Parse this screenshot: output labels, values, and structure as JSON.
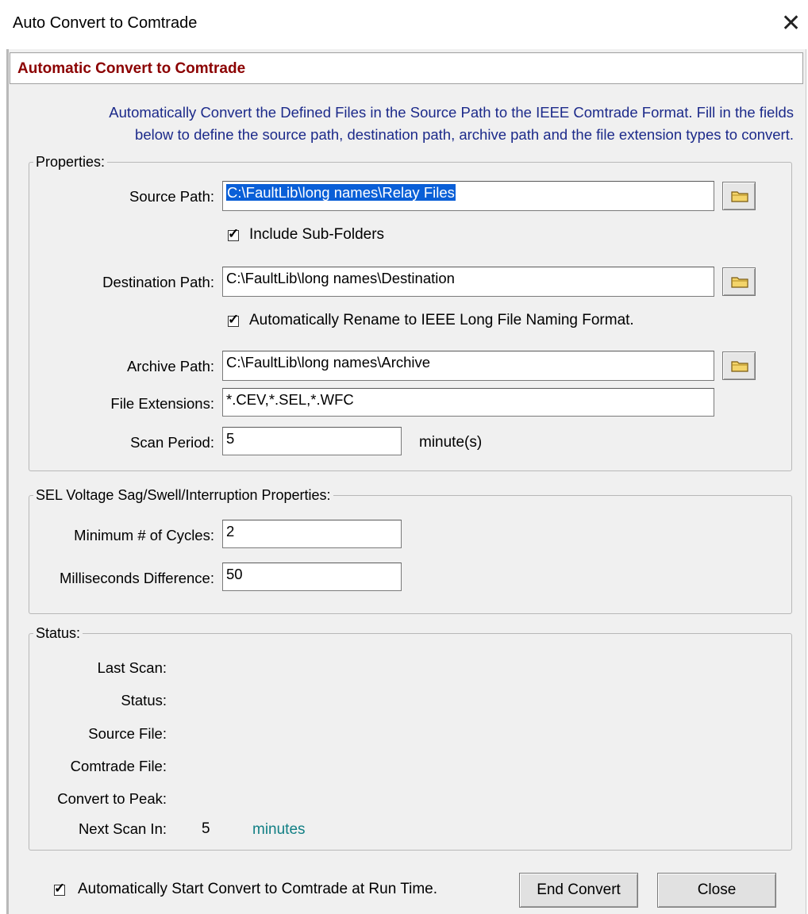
{
  "window": {
    "title": "Auto Convert to Comtrade",
    "close_glyph": "✕"
  },
  "header": {
    "title": "Automatic Convert to Comtrade"
  },
  "description": {
    "line1": "Automatically Convert the Defined Files in the Source Path to the IEEE Comtrade Format.  Fill in the fields",
    "line2": "below to define the source path, destination path, archive path and the file extension types to convert."
  },
  "properties": {
    "legend": "Properties:",
    "source_label": "Source Path:",
    "source_value": "C:\\FaultLib\\long names\\Relay Files",
    "include_subfolders_label": "Include Sub-Folders",
    "include_subfolders_checked": true,
    "destination_label": "Destination Path:",
    "destination_value": "C:\\FaultLib\\long names\\Destination",
    "rename_label": "Automatically Rename to IEEE Long File Naming Format.",
    "rename_checked": true,
    "archive_label": "Archive Path:",
    "archive_value": "C:\\FaultLib\\long names\\Archive",
    "extensions_label": "File Extensions:",
    "extensions_value": "*.CEV,*.SEL,*.WFC",
    "scan_label": "Scan Period:",
    "scan_value": "5",
    "scan_unit": "minute(s)"
  },
  "sel": {
    "legend": "SEL Voltage Sag/Swell/Interruption Properties:",
    "min_cycles_label": "Minimum # of Cycles:",
    "min_cycles_value": "2",
    "ms_diff_label": "Milliseconds Difference:",
    "ms_diff_value": "50"
  },
  "status": {
    "legend": "Status:",
    "last_scan_label": "Last Scan:",
    "status_label": "Status:",
    "source_file_label": "Source File:",
    "comtrade_file_label": "Comtrade File:",
    "convert_peak_label": "Convert to Peak:",
    "next_scan_label": "Next Scan In:",
    "next_scan_value": "5",
    "next_scan_unit": "minutes"
  },
  "footer": {
    "auto_start_label": "Automatically Start Convert to Comtrade at Run Time.",
    "auto_start_checked": true,
    "end_convert_label": "End Convert",
    "close_label": "Close"
  },
  "colors": {
    "header_text": "#8b0000",
    "description_text": "#1c2a8a",
    "accent_teal": "#117f84",
    "selection": "#0a5fd7"
  },
  "icons": {
    "browse": "folder-icon",
    "check": "checkmark"
  }
}
